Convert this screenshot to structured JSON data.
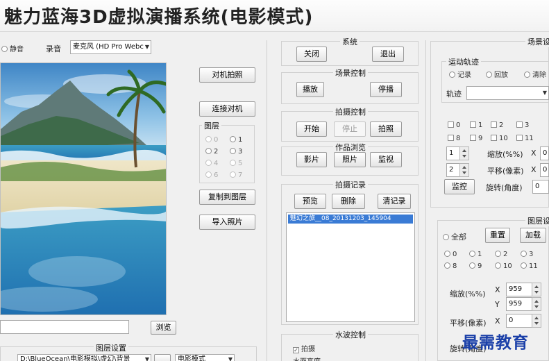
{
  "window": {
    "title": "魅力蓝海3D虚拟演播系统(电影模式)"
  },
  "left_panel": {
    "mute_label": "静音",
    "audio_label": "录音",
    "audio_device": "麦克风 (HD Pro Webc",
    "path_value": "",
    "browse_label": "浏览",
    "layer_settings_title": "图层设置",
    "bottom_path_value": "D:\\BlueOcean\\电影模拟\\虚幻\\背景",
    "bottom_mode_value": "电影模式"
  },
  "camera_panel": {
    "shoot_button": "对机拍照",
    "connect_button": "连接对机",
    "layer_group_title": "图层",
    "layer_options": [
      "0",
      "1",
      "2",
      "3",
      "4",
      "5",
      "6",
      "7"
    ],
    "copy_to_layer_button": "复制到图层",
    "import_photo_button": "导入照片"
  },
  "center_panel": {
    "system": {
      "title": "系统",
      "close": "关闭",
      "exit": "退出"
    },
    "scene_control": {
      "title": "场景控制",
      "play": "播放",
      "pause": "停播"
    },
    "shoot_control": {
      "title": "拍摄控制",
      "start": "开始",
      "stop": "停止",
      "photo": "拍照"
    },
    "work_browse": {
      "title": "作品浏览",
      "video": "影片",
      "photo": "照片",
      "monitor": "监视"
    },
    "shoot_record": {
      "title": "拍摄记录",
      "preview": "预览",
      "delete": "删除",
      "clear": "清记录",
      "items": [
        "魅幻之旅__08_20131203_145904"
      ]
    },
    "water_control": {
      "title": "水波控制",
      "splash_label": "拍摄",
      "wave_label": "水面高度"
    }
  },
  "right_panel": {
    "scene_settings": {
      "title": "场景设置",
      "motion_track_title": "运动轨迹",
      "motion_modes": [
        "记录",
        "回放",
        "清除"
      ],
      "track_label": "轨迹",
      "track_value": "",
      "checks_row1": [
        "0",
        "1",
        "2",
        "3"
      ],
      "checks_row2": [
        "8",
        "9",
        "10",
        "11"
      ],
      "spin1_value": "1",
      "spin2_value": "2",
      "scale_label": "缩放(%%)",
      "offset_label": "平移(像素)",
      "rotate_label": "旋转(角度)",
      "x_label": "X",
      "value_0": "0",
      "monitor_button": "监控"
    },
    "layer_settings": {
      "title": "图层设置",
      "all_label": "全部",
      "reset_button": "重置",
      "add_button": "加载",
      "radios_row1": [
        "0",
        "1",
        "2",
        "3"
      ],
      "radios_row2": [
        "8",
        "9",
        "10",
        "11"
      ],
      "scale_label": "缩放(%%)",
      "x_label": "X",
      "y_label": "Y",
      "scale_x": "959",
      "scale_y": "959",
      "offset_label": "平移(像素)",
      "offset_x": "0",
      "rotate_label": "旋转(角度)"
    }
  },
  "watermark": "最需教育"
}
